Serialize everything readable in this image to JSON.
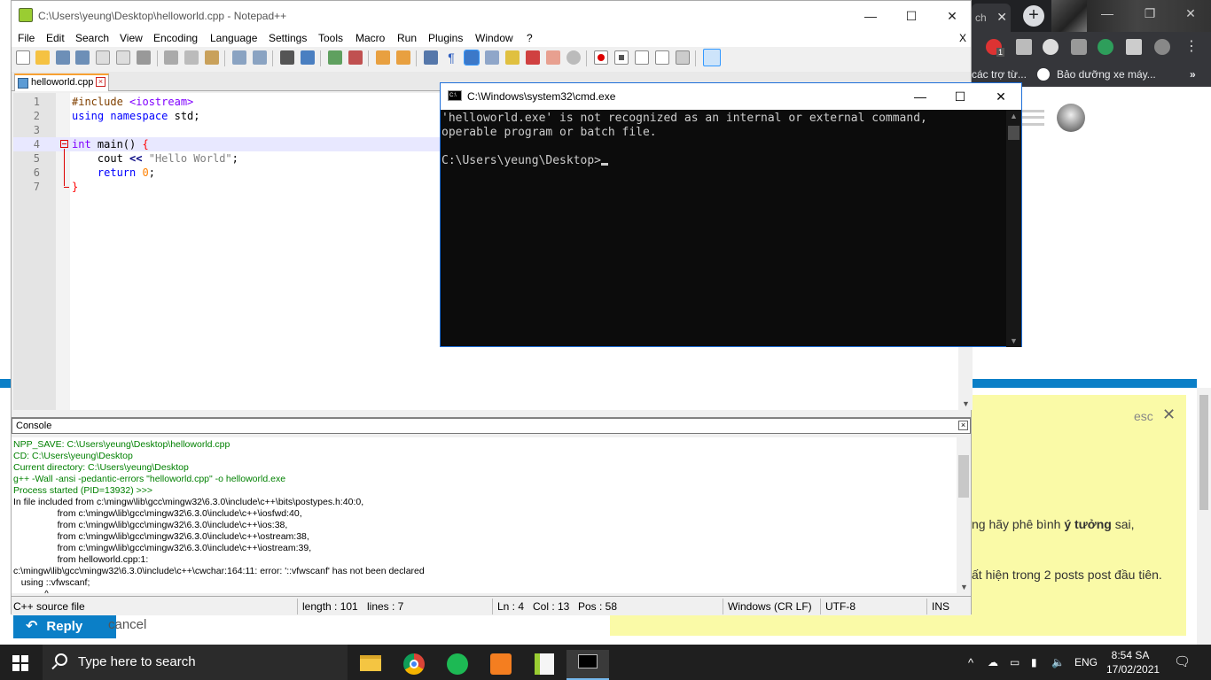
{
  "browser": {
    "tab_text": "ch",
    "bookmark1": "các trợ từ...",
    "bookmark2": "Bảo dưỡng xe máy...",
    "bookmark_more": "»",
    "ext_badge": "1"
  },
  "webpage": {
    "esc_label": "esc",
    "close_label": "✕",
    "line1_prefix": "ng hãy phê bình ",
    "line1_bold": "ý tưởng",
    "line1_suffix": " sai,",
    "line2": "ất hiện trong 2 posts post đầu tiên.",
    "reply_label": "Reply",
    "cancel_label": "cancel"
  },
  "notepad": {
    "title": "C:\\Users\\yeung\\Desktop\\helloworld.cpp - Notepad++",
    "menu": [
      "File",
      "Edit",
      "Search",
      "View",
      "Encoding",
      "Language",
      "Settings",
      "Tools",
      "Macro",
      "Run",
      "Plugins",
      "Window",
      "?"
    ],
    "menu_close": "X",
    "tab_name": "helloworld.cpp",
    "code_lines": [
      {
        "n": "1",
        "text": "#include <iostream>"
      },
      {
        "n": "2",
        "text": "using namespace std;"
      },
      {
        "n": "3",
        "text": ""
      },
      {
        "n": "4",
        "text": "int main() {"
      },
      {
        "n": "5",
        "text": "    cout << \"Hello World\";"
      },
      {
        "n": "6",
        "text": "    return 0;"
      },
      {
        "n": "7",
        "text": "}"
      }
    ],
    "console_title": "Console",
    "console_lines": [
      {
        "c": "green",
        "t": "NPP_SAVE: C:\\Users\\yeung\\Desktop\\helloworld.cpp"
      },
      {
        "c": "green",
        "t": "CD: C:\\Users\\yeung\\Desktop"
      },
      {
        "c": "green",
        "t": "Current directory: C:\\Users\\yeung\\Desktop"
      },
      {
        "c": "green",
        "t": "g++ -Wall -ansi -pedantic-errors \"helloworld.cpp\" -o helloworld.exe"
      },
      {
        "c": "green",
        "t": "Process started (PID=13932) >>>"
      },
      {
        "c": "black",
        "t": "In file included from c:\\mingw\\lib\\gcc\\mingw32\\6.3.0\\include\\c++\\bits\\postypes.h:40:0,"
      },
      {
        "c": "black",
        "t": "                 from c:\\mingw\\lib\\gcc\\mingw32\\6.3.0\\include\\c++\\iosfwd:40,"
      },
      {
        "c": "black",
        "t": "                 from c:\\mingw\\lib\\gcc\\mingw32\\6.3.0\\include\\c++\\ios:38,"
      },
      {
        "c": "black",
        "t": "                 from c:\\mingw\\lib\\gcc\\mingw32\\6.3.0\\include\\c++\\ostream:38,"
      },
      {
        "c": "black",
        "t": "                 from c:\\mingw\\lib\\gcc\\mingw32\\6.3.0\\include\\c++\\iostream:39,"
      },
      {
        "c": "black",
        "t": "                 from helloworld.cpp:1:"
      },
      {
        "c": "black",
        "t": "c:\\mingw\\lib\\gcc\\mingw32\\6.3.0\\include\\c++\\cwchar:164:11: error: '::vfwscanf' has not been declared"
      },
      {
        "c": "black",
        "t": "   using ::vfwscanf;"
      },
      {
        "c": "black",
        "t": "            ^"
      }
    ],
    "status": {
      "filetype": "C++ source file",
      "length": "length : 101",
      "lines": "lines : 7",
      "ln": "Ln : 4",
      "col": "Col : 13",
      "pos": "Pos : 58",
      "eol": "Windows (CR LF)",
      "encoding": "UTF-8",
      "mode": "INS"
    }
  },
  "cmd": {
    "title": "C:\\Windows\\system32\\cmd.exe",
    "icon_text": "C:\\",
    "lines": [
      "'helloworld.exe' is not recognized as an internal or external command,",
      "operable program or batch file.",
      "",
      "C:\\Users\\yeung\\Desktop>"
    ]
  },
  "taskbar": {
    "search_placeholder": "Type here to search",
    "lang": "ENG",
    "time": "8:54 SA",
    "date": "17/02/2021"
  },
  "colors": {
    "cmd_bg": "#0c0c0c",
    "cmd_text": "#cccccc",
    "console_green": "#008000",
    "taskbar": "#1f1f1f",
    "note_yellow": "#fafaa7",
    "link_blue": "#0b7fc7"
  }
}
